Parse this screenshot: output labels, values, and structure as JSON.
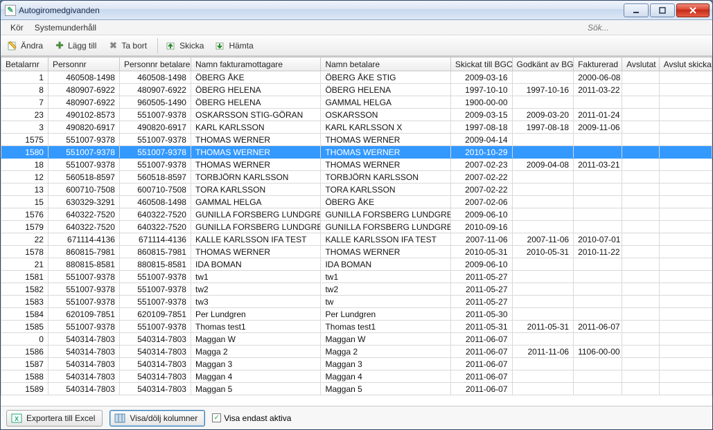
{
  "window": {
    "title": "Autogiromedgivanden"
  },
  "menu": {
    "kor": "Kör",
    "system": "Systemunderhåll"
  },
  "search": {
    "placeholder": "Sök..."
  },
  "toolbar": {
    "andra": "Ändra",
    "lagg_till": "Lägg till",
    "ta_bort": "Ta bort",
    "skicka": "Skicka",
    "hamta": "Hämta"
  },
  "columns": {
    "betalarnr": "Betalarnr",
    "personnr": "Personnr",
    "personnr_betalare": "Personnr betalare",
    "namn_fakturamottagare": "Namn fakturamottagare",
    "namn_betalare": "Namn betalare",
    "skickat_till_bgc": "Skickat till BGC",
    "godkant_av_bgc": "Godkänt av BGC",
    "fakturerad": "Fakturerad",
    "avslutat": "Avslutat",
    "avslut_skickat": "Avslut skickat"
  },
  "rows": [
    {
      "betalarnr": "1",
      "personnr": "460508-1498",
      "personnr_betalare": "460508-1498",
      "namn_fm": "ÖBERG ÅKE",
      "namn_b": "ÖBERG ÅKE STIG",
      "skickat": "2009-03-16",
      "godkant": "",
      "fakturerad": "2000-06-08",
      "avslutat": "",
      "avslut_skickat": ""
    },
    {
      "betalarnr": "8",
      "personnr": "480907-6922",
      "personnr_betalare": "480907-6922",
      "namn_fm": "ÖBERG HELENA",
      "namn_b": "ÖBERG HELENA",
      "skickat": "1997-10-10",
      "godkant": "1997-10-16",
      "fakturerad": "2011-03-22",
      "avslutat": "",
      "avslut_skickat": ""
    },
    {
      "betalarnr": "7",
      "personnr": "480907-6922",
      "personnr_betalare": "960505-1490",
      "namn_fm": "ÖBERG HELENA",
      "namn_b": "GAMMAL HELGA",
      "skickat": "1900-00-00",
      "godkant": "",
      "fakturerad": "",
      "avslutat": "",
      "avslut_skickat": ""
    },
    {
      "betalarnr": "23",
      "personnr": "490102-8573",
      "personnr_betalare": "551007-9378",
      "namn_fm": "OSKARSSON STIG-GÖRAN",
      "namn_b": "OSKARSSON",
      "skickat": "2009-03-15",
      "godkant": "2009-03-20",
      "fakturerad": "2011-01-24",
      "avslutat": "",
      "avslut_skickat": ""
    },
    {
      "betalarnr": "3",
      "personnr": "490820-6917",
      "personnr_betalare": "490820-6917",
      "namn_fm": "KARL KARLSSON",
      "namn_b": "KARL KARLSSON X",
      "skickat": "1997-08-18",
      "godkant": "1997-08-18",
      "fakturerad": "2009-11-06",
      "avslutat": "",
      "avslut_skickat": ""
    },
    {
      "betalarnr": "1575",
      "personnr": "551007-9378",
      "personnr_betalare": "551007-9378",
      "namn_fm": "THOMAS WERNER",
      "namn_b": "THOMAS WERNER",
      "skickat": "2009-04-14",
      "godkant": "",
      "fakturerad": "",
      "avslutat": "",
      "avslut_skickat": ""
    },
    {
      "betalarnr": "1580",
      "personnr": "551007-9378",
      "personnr_betalare": "551007-9378",
      "namn_fm": "THOMAS WERNER",
      "namn_b": "THOMAS WERNER",
      "skickat": "2010-10-29",
      "godkant": "",
      "fakturerad": "",
      "avslutat": "",
      "avslut_skickat": "",
      "selected": true
    },
    {
      "betalarnr": "18",
      "personnr": "551007-9378",
      "personnr_betalare": "551007-9378",
      "namn_fm": "THOMAS WERNER",
      "namn_b": "THOMAS WERNER",
      "skickat": "2007-02-23",
      "godkant": "2009-04-08",
      "fakturerad": "2011-03-21",
      "avslutat": "",
      "avslut_skickat": ""
    },
    {
      "betalarnr": "12",
      "personnr": "560518-8597",
      "personnr_betalare": "560518-8597",
      "namn_fm": "TORBJÖRN KARLSSON",
      "namn_b": "TORBJÖRN KARLSSON",
      "skickat": "2007-02-22",
      "godkant": "",
      "fakturerad": "",
      "avslutat": "",
      "avslut_skickat": ""
    },
    {
      "betalarnr": "13",
      "personnr": "600710-7508",
      "personnr_betalare": "600710-7508",
      "namn_fm": "TORA KARLSSON",
      "namn_b": "TORA KARLSSON",
      "skickat": "2007-02-22",
      "godkant": "",
      "fakturerad": "",
      "avslutat": "",
      "avslut_skickat": ""
    },
    {
      "betalarnr": "15",
      "personnr": "630329-3291",
      "personnr_betalare": "460508-1498",
      "namn_fm": "GAMMAL HELGA",
      "namn_b": "ÖBERG ÅKE",
      "skickat": "2007-02-06",
      "godkant": "",
      "fakturerad": "",
      "avslutat": "",
      "avslut_skickat": ""
    },
    {
      "betalarnr": "1576",
      "personnr": "640322-7520",
      "personnr_betalare": "640322-7520",
      "namn_fm": "GUNILLA FORSBERG LUNDGREN",
      "namn_b": "GUNILLA FORSBERG LUNDGREN",
      "skickat": "2009-06-10",
      "godkant": "",
      "fakturerad": "",
      "avslutat": "",
      "avslut_skickat": ""
    },
    {
      "betalarnr": "1579",
      "personnr": "640322-7520",
      "personnr_betalare": "640322-7520",
      "namn_fm": "GUNILLA FORSBERG LUNDGREN",
      "namn_b": "GUNILLA FORSBERG LUNDGREN",
      "skickat": "2010-09-16",
      "godkant": "",
      "fakturerad": "",
      "avslutat": "",
      "avslut_skickat": ""
    },
    {
      "betalarnr": "22",
      "personnr": "671114-4136",
      "personnr_betalare": "671114-4136",
      "namn_fm": "KALLE KARLSSON IFA TEST",
      "namn_b": "KALLE KARLSSON IFA TEST",
      "skickat": "2007-11-06",
      "godkant": "2007-11-06",
      "fakturerad": "2010-07-01",
      "avslutat": "",
      "avslut_skickat": ""
    },
    {
      "betalarnr": "1578",
      "personnr": "860815-7981",
      "personnr_betalare": "860815-7981",
      "namn_fm": "THOMAS WERNER",
      "namn_b": "THOMAS WERNER",
      "skickat": "2010-05-31",
      "godkant": "2010-05-31",
      "fakturerad": "2010-11-22",
      "avslutat": "",
      "avslut_skickat": ""
    },
    {
      "betalarnr": "21",
      "personnr": "880815-8581",
      "personnr_betalare": "880815-8581",
      "namn_fm": "IDA BOMAN",
      "namn_b": "IDA BOMAN",
      "skickat": "2009-06-10",
      "godkant": "",
      "fakturerad": "",
      "avslutat": "",
      "avslut_skickat": ""
    },
    {
      "betalarnr": "1581",
      "personnr": "551007-9378",
      "personnr_betalare": "551007-9378",
      "namn_fm": "tw1",
      "namn_b": "tw1",
      "skickat": "2011-05-27",
      "godkant": "",
      "fakturerad": "",
      "avslutat": "",
      "avslut_skickat": ""
    },
    {
      "betalarnr": "1582",
      "personnr": "551007-9378",
      "personnr_betalare": "551007-9378",
      "namn_fm": "tw2",
      "namn_b": "tw2",
      "skickat": "2011-05-27",
      "godkant": "",
      "fakturerad": "",
      "avslutat": "",
      "avslut_skickat": ""
    },
    {
      "betalarnr": "1583",
      "personnr": "551007-9378",
      "personnr_betalare": "551007-9378",
      "namn_fm": "tw3",
      "namn_b": "tw",
      "skickat": "2011-05-27",
      "godkant": "",
      "fakturerad": "",
      "avslutat": "",
      "avslut_skickat": ""
    },
    {
      "betalarnr": "1584",
      "personnr": "620109-7851",
      "personnr_betalare": "620109-7851",
      "namn_fm": "Per Lundgren",
      "namn_b": "Per Lundgren",
      "skickat": "2011-05-30",
      "godkant": "",
      "fakturerad": "",
      "avslutat": "",
      "avslut_skickat": ""
    },
    {
      "betalarnr": "1585",
      "personnr": "551007-9378",
      "personnr_betalare": "551007-9378",
      "namn_fm": "Thomas test1",
      "namn_b": "Thomas test1",
      "skickat": "2011-05-31",
      "godkant": "2011-05-31",
      "fakturerad": "2011-06-07",
      "avslutat": "",
      "avslut_skickat": ""
    },
    {
      "betalarnr": "0",
      "personnr": "540314-7803",
      "personnr_betalare": "540314-7803",
      "namn_fm": "Maggan W",
      "namn_b": "Maggan W",
      "skickat": "2011-06-07",
      "godkant": "",
      "fakturerad": "",
      "avslutat": "",
      "avslut_skickat": ""
    },
    {
      "betalarnr": "1586",
      "personnr": "540314-7803",
      "personnr_betalare": "540314-7803",
      "namn_fm": "Magga 2",
      "namn_b": "Magga 2",
      "skickat": "2011-06-07",
      "godkant": "2011-11-06",
      "fakturerad": "1106-00-00",
      "avslutat": "",
      "avslut_skickat": ""
    },
    {
      "betalarnr": "1587",
      "personnr": "540314-7803",
      "personnr_betalare": "540314-7803",
      "namn_fm": "Maggan 3",
      "namn_b": "Maggan 3",
      "skickat": "2011-06-07",
      "godkant": "",
      "fakturerad": "",
      "avslutat": "",
      "avslut_skickat": ""
    },
    {
      "betalarnr": "1588",
      "personnr": "540314-7803",
      "personnr_betalare": "540314-7803",
      "namn_fm": "Maggan 4",
      "namn_b": "Maggan 4",
      "skickat": "2011-06-07",
      "godkant": "",
      "fakturerad": "",
      "avslutat": "",
      "avslut_skickat": ""
    },
    {
      "betalarnr": "1589",
      "personnr": "540314-7803",
      "personnr_betalare": "540314-7803",
      "namn_fm": "Maggan 5",
      "namn_b": "Maggan 5",
      "skickat": "2011-06-07",
      "godkant": "",
      "fakturerad": "",
      "avslutat": "",
      "avslut_skickat": ""
    }
  ],
  "footer": {
    "export_excel": "Exportera till Excel",
    "show_hide_cols": "Visa/dölj kolumner",
    "show_active_only": "Visa endast aktiva",
    "show_active_only_checked": true
  }
}
